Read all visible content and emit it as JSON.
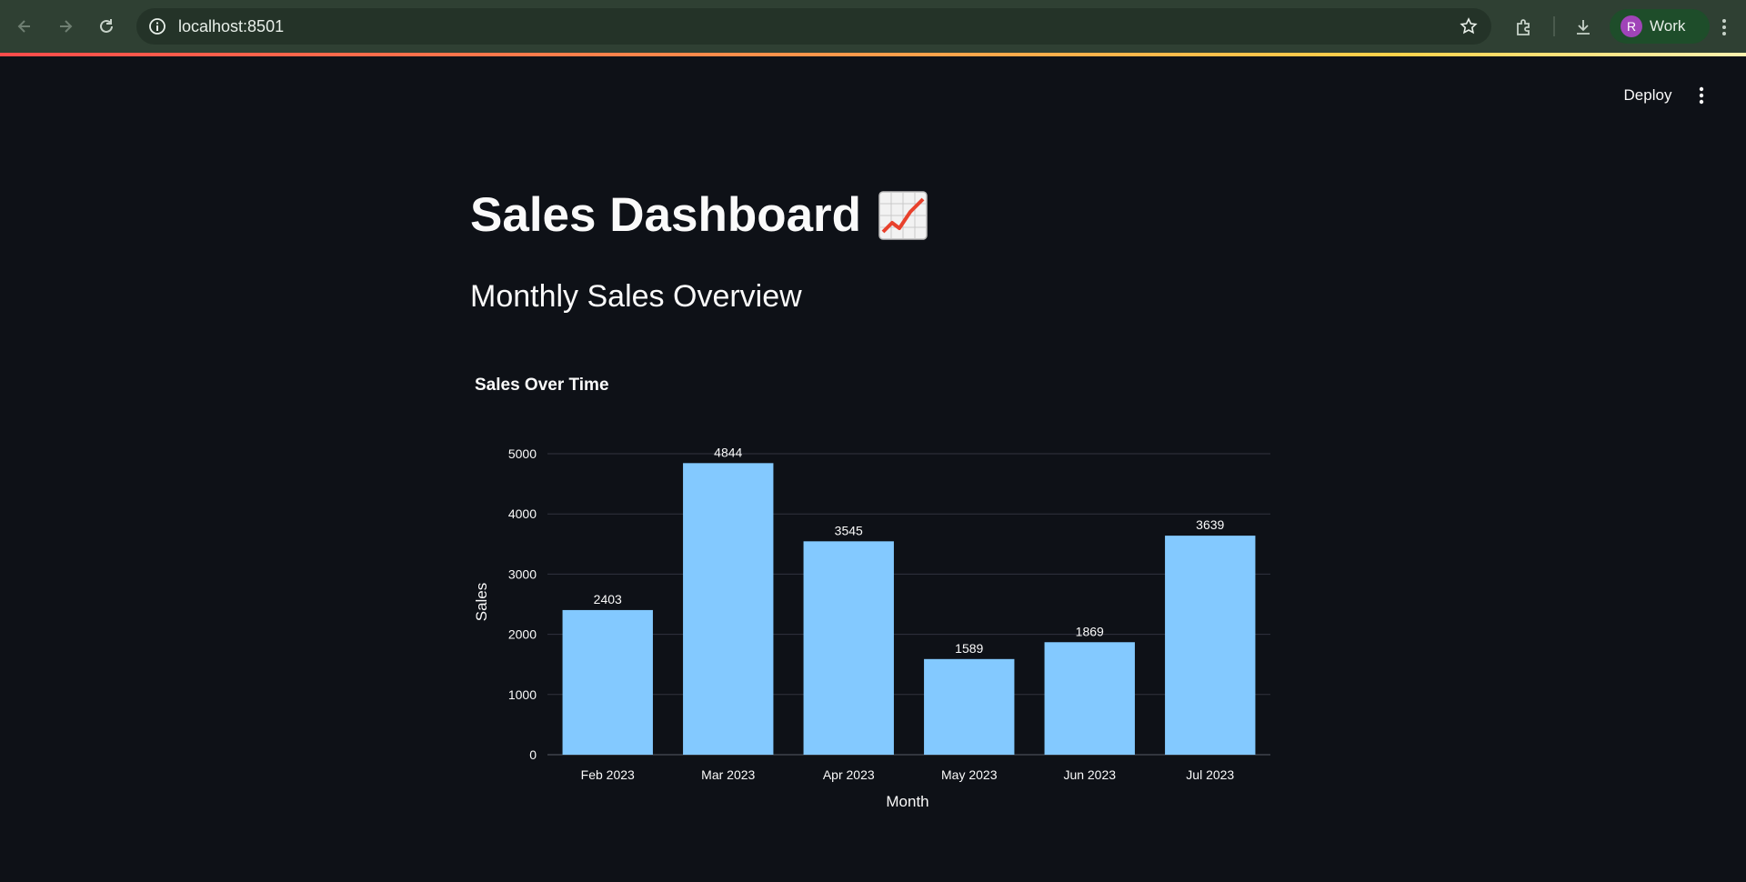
{
  "browser": {
    "url": "localhost:8501",
    "profile_initial": "R",
    "profile_name": "Work",
    "icons": [
      "back-icon",
      "forward-icon",
      "reload-icon",
      "site-info-icon",
      "bookmark-star-icon",
      "extensions-icon",
      "download-icon",
      "menu-icon"
    ]
  },
  "app": {
    "deploy_label": "Deploy",
    "title": "Sales Dashboard",
    "title_emoji": "chart-increasing-icon",
    "subheader": "Monthly Sales Overview"
  },
  "colors": {
    "background": "#0e1117",
    "bar": "#83c9ff",
    "gridline": "#31333f"
  },
  "chart_data": {
    "type": "bar",
    "title": "Sales Over Time",
    "xlabel": "Month",
    "ylabel": "Sales",
    "categories": [
      "Feb 2023",
      "Mar 2023",
      "Apr 2023",
      "May 2023",
      "Jun 2023",
      "Jul 2023"
    ],
    "values": [
      2403,
      4844,
      3545,
      1589,
      1869,
      3639
    ],
    "data_labels": [
      "2403",
      "4844",
      "3545",
      "1589",
      "1869",
      "3639"
    ],
    "y_ticks": [
      0,
      1000,
      2000,
      3000,
      4000,
      5000
    ],
    "ylim": [
      0,
      5000
    ],
    "grid": true,
    "legend": "none"
  }
}
